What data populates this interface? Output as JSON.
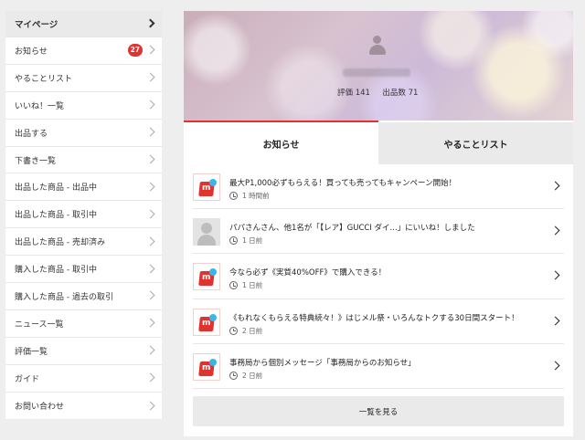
{
  "sidebar": {
    "items": [
      {
        "label": "マイページ"
      },
      {
        "label": "お知らせ",
        "badge": "27"
      },
      {
        "label": "やることリスト"
      },
      {
        "label": "いいね！一覧"
      },
      {
        "label": "出品する"
      },
      {
        "label": "下書き一覧"
      },
      {
        "label": "出品した商品 - 出品中"
      },
      {
        "label": "出品した商品 - 取引中"
      },
      {
        "label": "出品した商品 - 売却済み"
      },
      {
        "label": "購入した商品 - 取引中"
      },
      {
        "label": "購入した商品 - 過去の取引"
      },
      {
        "label": "ニュース一覧"
      },
      {
        "label": "評価一覧"
      },
      {
        "label": "ガイド"
      },
      {
        "label": "お問い合わせ"
      }
    ]
  },
  "profile": {
    "rating_label": "評価",
    "rating_value": "141",
    "listings_label": "出品数",
    "listings_value": "71"
  },
  "tabs": [
    {
      "label": "お知らせ",
      "active": true
    },
    {
      "label": "やることリスト",
      "active": false
    }
  ],
  "notifications": [
    {
      "icon": "mercari-logo-icon",
      "message": "最大P1,000必ずもらえる！買っても売ってもキャンペーン開始！",
      "time": "1 時間前"
    },
    {
      "icon": "user-avatar-icon",
      "message": "パパさんさん、他1名が「【レア】GUCCI ダイ...」にいいね！しました",
      "time": "1 日前"
    },
    {
      "icon": "mercari-logo-icon",
      "message": "今なら必ず《実質40%OFF》で購入できる！",
      "time": "1 日前"
    },
    {
      "icon": "mercari-logo-icon",
      "message": "《もれなくもらえる特典続々！》はじメル祭・いろんなトクする30日間スタート！",
      "time": "2 日前"
    },
    {
      "icon": "mercari-logo-icon",
      "message": "事務局から個別メッセージ「事務局からのお知らせ」",
      "time": "2 日前"
    }
  ],
  "see_all_label": "一覧を見る",
  "colors": {
    "accent": "#e0332f",
    "logo_dot": "#3cb5e8"
  }
}
